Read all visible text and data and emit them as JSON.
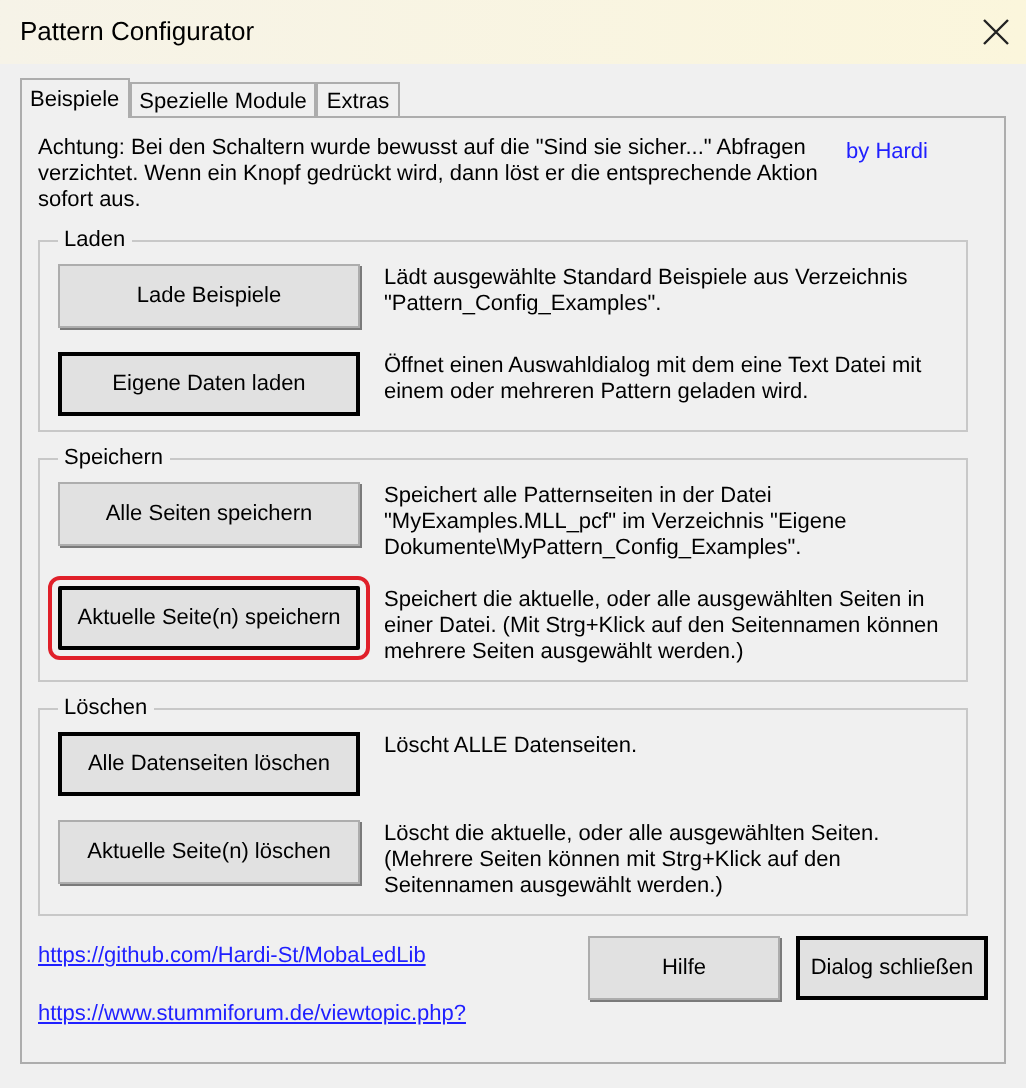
{
  "window": {
    "title": "Pattern Configurator"
  },
  "tabs": [
    {
      "label": "Beispiele",
      "selected": true
    },
    {
      "label": "Spezielle Module",
      "selected": false
    },
    {
      "label": "Extras",
      "selected": false
    }
  ],
  "notice": {
    "text": "Achtung: Bei den Schaltern wurde bewusst auf die \"Sind sie sicher...\" Abfragen verzichtet. Wenn ein Knopf gedrückt wird, dann löst er die entsprechende Aktion sofort aus.",
    "author": "by Hardi"
  },
  "groups": [
    {
      "title": "Laden",
      "actions": [
        {
          "button": "Lade Beispiele",
          "emphasized": false,
          "highlighted": false,
          "description": "Lädt ausgewählte Standard Beispiele aus Verzeichnis \"Pattern_Config_Examples\"."
        },
        {
          "button": "Eigene Daten laden",
          "emphasized": true,
          "highlighted": false,
          "description": "Öffnet einen Auswahldialog mit dem eine Text Datei mit einem oder mehreren Pattern geladen wird."
        }
      ]
    },
    {
      "title": "Speichern",
      "actions": [
        {
          "button": "Alle Seiten speichern",
          "emphasized": false,
          "highlighted": false,
          "description": "Speichert alle Patternseiten in der Datei \"MyExamples.MLL_pcf\" im Verzeichnis \"Eigene Dokumente\\MyPattern_Config_Examples\"."
        },
        {
          "button": "Aktuelle Seite(n) speichern",
          "emphasized": true,
          "highlighted": true,
          "description": "Speichert die aktuelle, oder alle ausgewählten Seiten in einer Datei. (Mit Strg+Klick auf den Seitennamen können mehrere Seiten ausgewählt werden.)"
        }
      ]
    },
    {
      "title": "Löschen",
      "actions": [
        {
          "button": "Alle Datenseiten löschen",
          "emphasized": true,
          "highlighted": false,
          "description": "Löscht ALLE Datenseiten."
        },
        {
          "button": "Aktuelle Seite(n) löschen",
          "emphasized": false,
          "highlighted": false,
          "description": "Löscht die aktuelle, oder alle ausgewählten Seiten. (Mehrere Seiten können mit Strg+Klick auf den Seitennamen ausgewählt werden.)"
        }
      ]
    }
  ],
  "links": [
    "https://github.com/Hardi-St/MobaLedLib",
    "https://www.stummiforum.de/viewtopic.php?"
  ],
  "buttons": [
    {
      "label": "Hilfe",
      "emphasized": false
    },
    {
      "label": "Dialog schließen",
      "emphasized": true
    }
  ]
}
